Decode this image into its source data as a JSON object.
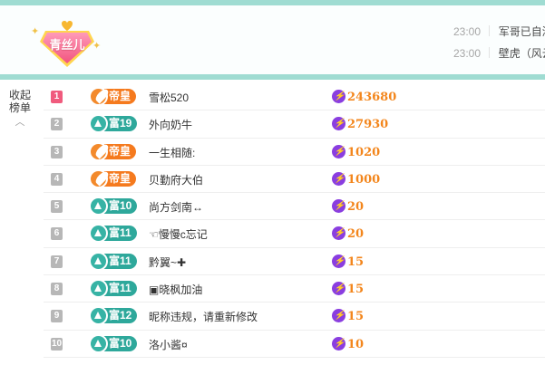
{
  "header": {
    "badge_label": "青丝儿",
    "messages": [
      {
        "time": "23:00",
        "text": "军哥已自添"
      },
      {
        "time": "23:00",
        "text": "壁虎（风云"
      }
    ]
  },
  "sidebar": {
    "toggle_line1": "收起",
    "toggle_line2": "榜单",
    "toggle_icon": "chevron-up-icon"
  },
  "colors": {
    "accent_teal": "#9fdcd2",
    "rank_first": "#f05b7d",
    "emperor_orange": "#f57a1e",
    "rich_teal": "#2ea89b",
    "value_orange": "#f3861c",
    "bolt_purple": "#8a3ee0"
  },
  "ranking": [
    {
      "rank": "1",
      "level": "帝皇",
      "level_type": "emperor",
      "name": "雪松520",
      "value": "243680"
    },
    {
      "rank": "2",
      "level": "富19",
      "level_type": "rich",
      "name": "外向奶牛",
      "value": "27930"
    },
    {
      "rank": "3",
      "level": "帝皇",
      "level_type": "emperor",
      "name": "一生相随:",
      "value": "1020"
    },
    {
      "rank": "4",
      "level": "帝皇",
      "level_type": "emperor",
      "name": "贝勤府大伯",
      "value": "1000"
    },
    {
      "rank": "5",
      "level": "富10",
      "level_type": "rich",
      "name": "尚方剑南↔",
      "value": "20"
    },
    {
      "rank": "6",
      "level": "富11",
      "level_type": "rich",
      "name": "☜慢慢c忘记",
      "value": "20"
    },
    {
      "rank": "7",
      "level": "富11",
      "level_type": "rich",
      "name": "黔翼~✚",
      "value": "15"
    },
    {
      "rank": "8",
      "level": "富11",
      "level_type": "rich",
      "name": "▣晓枫加油",
      "value": "15"
    },
    {
      "rank": "9",
      "level": "富12",
      "level_type": "rich",
      "name": "昵称违规，请重新修改",
      "value": "15"
    },
    {
      "rank": "10",
      "level": "富10",
      "level_type": "rich",
      "name": "洛小酱¤",
      "value": "10"
    }
  ]
}
